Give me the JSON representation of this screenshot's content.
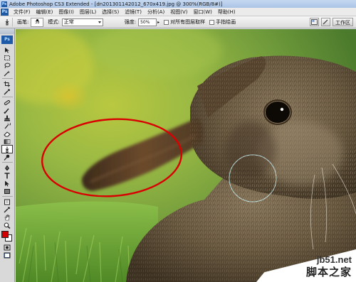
{
  "window": {
    "title": "Adobe Photoshop CS3 Extended - [dn201301142012_670x419.jpg @ 300%(RGB/8#)]"
  },
  "menubar": {
    "logo": "Ps",
    "items": [
      "文件(F)",
      "编辑(E)",
      "图像(I)",
      "图层(L)",
      "选择(S)",
      "滤镜(T)",
      "分析(A)",
      "视图(V)",
      "窗口(W)",
      "帮助(H)"
    ]
  },
  "options": {
    "brush_label": "画笔:",
    "brush_size": "38",
    "mode_label": "模式:",
    "mode_value": "正常",
    "strength_label": "强度:",
    "strength_value": "50%",
    "sample_all_label": "对所有图层取样",
    "finger_paint_label": "手指绘画",
    "workspace_label": "工作区"
  },
  "toolbox": {
    "logo": "Ps",
    "tools": [
      "move-tool-icon",
      "marquee-tool-icon",
      "lasso-tool-icon",
      "magic-wand-tool-icon",
      "crop-tool-icon",
      "eyedropper-tool-icon",
      "healing-brush-tool-icon",
      "brush-tool-icon",
      "clone-stamp-tool-icon",
      "history-brush-tool-icon",
      "eraser-tool-icon",
      "gradient-tool-icon",
      "smudge-tool-icon",
      "dodge-tool-icon",
      "pen-tool-icon",
      "type-tool-icon",
      "path-selection-tool-icon",
      "shape-tool-icon",
      "notes-tool-icon",
      "eyedropper2-tool-icon",
      "hand-tool-icon",
      "zoom-tool-icon"
    ],
    "foreground_color": "#d10000",
    "background_color": "#ffffff"
  },
  "canvas": {
    "annotation_color": "#d80000"
  },
  "watermark": {
    "url": "jb51.net",
    "text": "脚本之家"
  }
}
